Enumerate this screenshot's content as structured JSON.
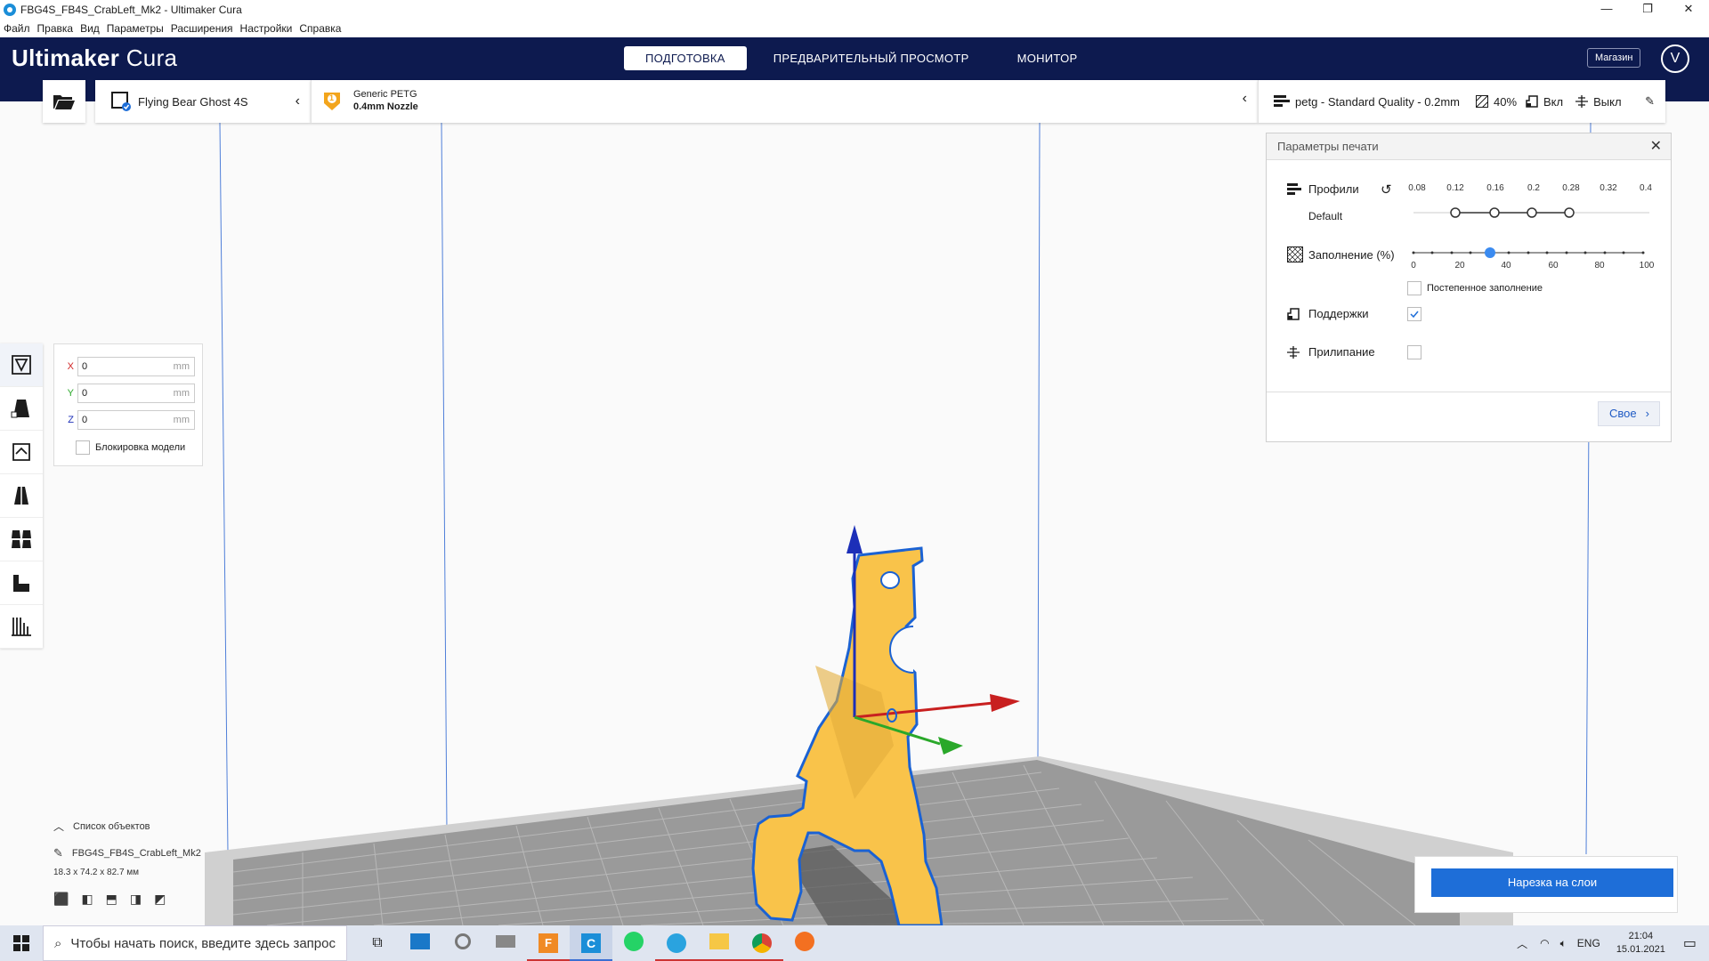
{
  "window": {
    "title": "FBG4S_FB4S_CrabLeft_Mk2 - Ultimaker Cura",
    "controls": [
      "—",
      "❐",
      "✕"
    ]
  },
  "menu": [
    "Файл",
    "Правка",
    "Вид",
    "Параметры",
    "Расширения",
    "Настройки",
    "Справка"
  ],
  "header": {
    "logo_bold": "Ultimaker",
    "logo_light": " Cura",
    "tabs": [
      {
        "label": "ПОДГОТОВКА",
        "active": true
      },
      {
        "label": "ПРЕДВАРИТЕЛЬНЫЙ ПРОСМОТР",
        "active": false
      },
      {
        "label": "МОНИТОР",
        "active": false
      }
    ],
    "marketplace": "Магазин",
    "avatar": "V"
  },
  "toolbar": {
    "printer": "Flying Bear Ghost 4S",
    "material_name": "Generic PETG",
    "nozzle": "0.4mm Nozzle",
    "material_badge": "1",
    "profile": "petg - Standard Quality - 0.2mm",
    "infill": "40%",
    "support": "Вкл",
    "adhesion": "Выкл"
  },
  "move_panel": {
    "x_label": "X",
    "x_value": "0",
    "y_label": "Y",
    "y_value": "0",
    "z_label": "Z",
    "z_value": "0",
    "unit": "mm",
    "lock_label": "Блокировка модели"
  },
  "print_settings": {
    "title": "Параметры печати",
    "profiles_label": "Профили",
    "profile_default": "Default",
    "layer_ticks": [
      "0.08",
      "0.12",
      "0.16",
      "0.2",
      "0.28",
      "0.32",
      "0.4"
    ],
    "infill_label": "Заполнение (%)",
    "infill_ticks": [
      "0",
      "20",
      "40",
      "60",
      "80",
      "100"
    ],
    "infill_value": 40,
    "gradual_label": "Постепенное заполнение",
    "support_label": "Поддержки",
    "support_checked": true,
    "adhesion_label": "Прилипание",
    "adhesion_checked": false,
    "custom_label": "Свое"
  },
  "object_list": {
    "header": "Список объектов",
    "name": "FBG4S_FB4S_CrabLeft_Mk2",
    "dims": "18.3 x 74.2 x 82.7 мм"
  },
  "slice_button": "Нарезка на слои",
  "taskbar": {
    "search_placeholder": "Чтобы начать поиск, введите здесь запрос",
    "lang": "ENG",
    "time": "21:04",
    "date": "15.01.2021"
  },
  "colors": {
    "header_bg": "#0d1a4f",
    "accent": "#1e6ed8",
    "model": "#f9c34a",
    "axis_x": "#c82020",
    "axis_y": "#2aa82a",
    "axis_z": "#1c2fb8"
  }
}
